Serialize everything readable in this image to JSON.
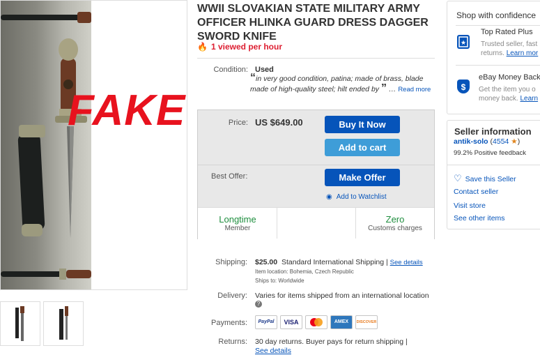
{
  "listing": {
    "title": "WWII SLOVAKIAN STATE MILITARY ARMY OFFICER HLINKA GUARD DRESS DAGGER SWORD KNIFE",
    "viewed": "1 viewed per hour",
    "overlay_text": "FAKE !!!"
  },
  "condition": {
    "label": "Condition:",
    "value": "Used",
    "description": "in very good condition, patina; made of brass, blade made of high-quality steel; hilt ended by",
    "read_more": "Read more"
  },
  "purchase": {
    "price_label": "Price:",
    "price": "US $649.00",
    "buy_now": "Buy It Now",
    "add_to_cart": "Add to cart",
    "best_offer_label": "Best Offer:",
    "make_offer": "Make Offer",
    "watchlist": "Add to Watchlist"
  },
  "badges": [
    {
      "main": "Longtime",
      "sub": "Member"
    },
    {
      "main": "Zero",
      "sub": "Customs charges"
    }
  ],
  "shipping": {
    "label": "Shipping:",
    "cost": "$25.00",
    "method": "Standard International Shipping |",
    "see_details": "See details",
    "location": "Item location:  Bohemia, Czech Republic",
    "ships_to": "Ships to:  Worldwide"
  },
  "delivery": {
    "label": "Delivery:",
    "text": "Varies for items shipped from an international location"
  },
  "payments": {
    "label": "Payments:",
    "methods": [
      "PayPal",
      "VISA",
      "MC",
      "AMEX",
      "DISCOVER"
    ]
  },
  "returns": {
    "label": "Returns:",
    "text": "30 day returns. Buyer pays for return shipping |",
    "more": "See details"
  },
  "confidence": {
    "title": "Shop with confidence",
    "top_rated": {
      "head": "Top Rated Plus",
      "line1": "Trusted seller, fast",
      "line2": "returns.",
      "link": "Learn mor"
    },
    "guarantee": {
      "head": "eBay Money Back",
      "line1": "Get the item you o",
      "line2": "money back.",
      "link": "Learn"
    }
  },
  "seller": {
    "title": "Seller information",
    "name": "antik-solo",
    "score": "4554",
    "feedback": "99.2% Positive feedback",
    "save": "Save this Seller",
    "contact": "Contact seller",
    "store": "Visit store",
    "other": "See other items"
  },
  "colors": {
    "accent": "#0654ba",
    "cart": "#3e9dd8",
    "fake": "#e8121e",
    "badge_green": "#1e8e3e"
  }
}
